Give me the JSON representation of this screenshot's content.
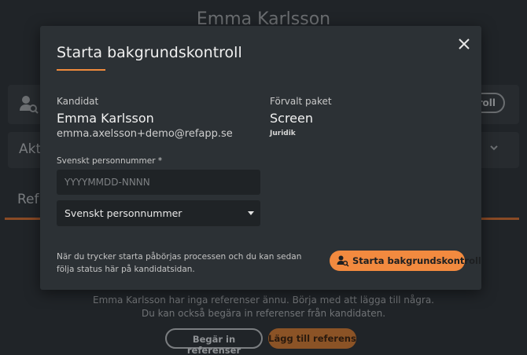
{
  "background": {
    "title": "Emma Karlsson",
    "pill_label": "roll",
    "section_label": "Akt",
    "tab_label": "Ref",
    "empty_line1": "Emma Karlsson har inga referenser ännu. Börja med att lägga till några.",
    "empty_line2": "Du kan också begära in referenser från kandidaten.",
    "request_button": "Begär in referenser",
    "add_button": "Lägg till referens"
  },
  "modal": {
    "title": "Starta bakgrundskontroll",
    "candidate_label": "Kandidat",
    "candidate_name": "Emma Karlsson",
    "candidate_email": "emma.axelsson+demo@refapp.se",
    "package_label": "Förvalt paket",
    "package_name": "Screen",
    "package_sub": "Juridik",
    "pnr_label": "Svenskt personnummer *",
    "pnr_placeholder": "YYYYMMDD-NNNN",
    "pnr_value": "",
    "id_type_selected": "Svenskt personnummer",
    "footer_text": "När du trycker starta påbörjas processen och du kan sedan följa status här på kandidatsidan.",
    "start_button": "Starta bakgrundskontroll"
  },
  "colors": {
    "accent": "#f28a3f",
    "modal_bg": "#2c3135",
    "page_bg": "#202428"
  },
  "icons": {
    "close": "close-icon",
    "user_search": "user-search-icon",
    "caret": "caret-down-icon"
  }
}
